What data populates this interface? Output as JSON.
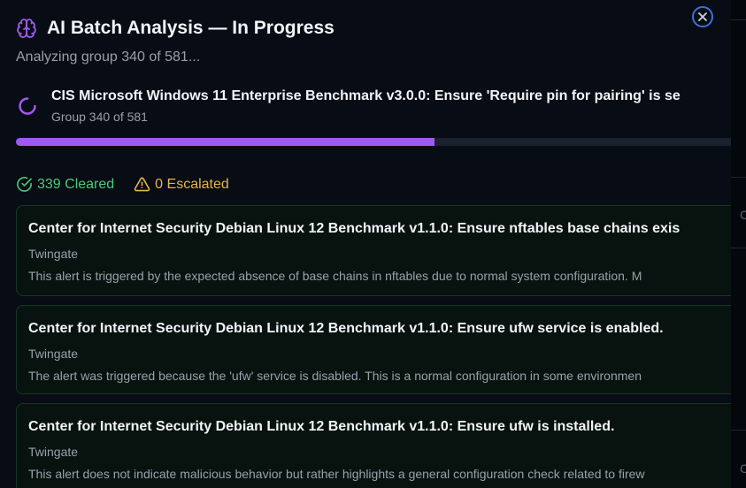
{
  "header": {
    "title": "AI Batch Analysis — In Progress",
    "subtitle": "Analyzing group 340 of 581..."
  },
  "current": {
    "title": "CIS Microsoft Windows 11 Enterprise Benchmark v3.0.0: Ensure 'Require pin for pairing' is se",
    "subtitle": "Group 340 of 581"
  },
  "progress": {
    "current": 340,
    "total": 581
  },
  "counts": {
    "cleared_label": "339 Cleared",
    "escalated_label": "0 Escalated"
  },
  "results": [
    {
      "title": "Center for Internet Security Debian Linux 12 Benchmark v1.1.0: Ensure nftables base chains exis",
      "source": "Twingate",
      "description": "This alert is triggered by the expected absence of base chains in nftables due to normal system configuration. M"
    },
    {
      "title": "Center for Internet Security Debian Linux 12 Benchmark v1.1.0: Ensure ufw service is enabled.",
      "source": "Twingate",
      "description": "The alert was triggered because the 'ufw' service is disabled. This is a normal configuration in some environmen"
    },
    {
      "title": "Center for Internet Security Debian Linux 12 Benchmark v1.1.0: Ensure ufw is installed.",
      "source": "Twingate",
      "description": "This alert does not indicate malicious behavior but rather highlights a general configuration check related to firew"
    }
  ],
  "backdrop": {
    "glyph": "C"
  },
  "colors": {
    "accent_purple": "#a259f0",
    "cleared_green": "#4ec97a",
    "escalated_amber": "#e6b548",
    "close_blue": "#3f6fd8"
  },
  "icons": {
    "title": "brain-icon",
    "loading": "spinner-icon",
    "cleared": "check-circle-icon",
    "escalated": "warning-triangle-icon",
    "close": "close-icon"
  }
}
